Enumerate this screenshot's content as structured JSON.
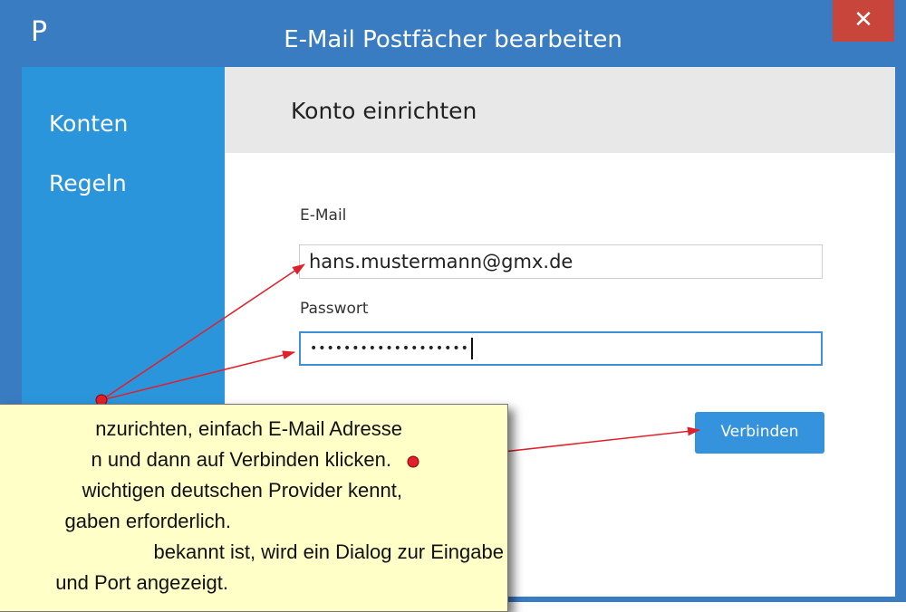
{
  "window": {
    "app_icon_glyph": "P",
    "title": "E-Mail Postfächer bearbeiten",
    "close_glyph": "✕"
  },
  "sidebar": {
    "items": [
      {
        "label": "Konten"
      },
      {
        "label": "Regeln"
      }
    ]
  },
  "content": {
    "header_title": "Konto einrichten",
    "email_label": "E-Mail",
    "email_value": "hans.mustermann@gmx.de",
    "password_label": "Passwort",
    "password_value": "•••••••••••••••••••",
    "connect_label": "Verbinden"
  },
  "tooltip": {
    "lines": [
      "nzurichten, einfach E-Mail Adresse",
      "n und dann auf Verbinden klicken.",
      "wichtigen deutschen Provider kennt,",
      "gaben erforderlich.",
      "bekannt ist, wird ein Dialog zur Eingabe",
      "und Port angezeigt."
    ]
  },
  "colors": {
    "frame": "#3a7cc2",
    "sidebar": "#2b95dc",
    "close": "#c7453b",
    "button": "#3593dd",
    "tooltip_bg": "#ffffc8",
    "annotation": "#e0202a"
  }
}
